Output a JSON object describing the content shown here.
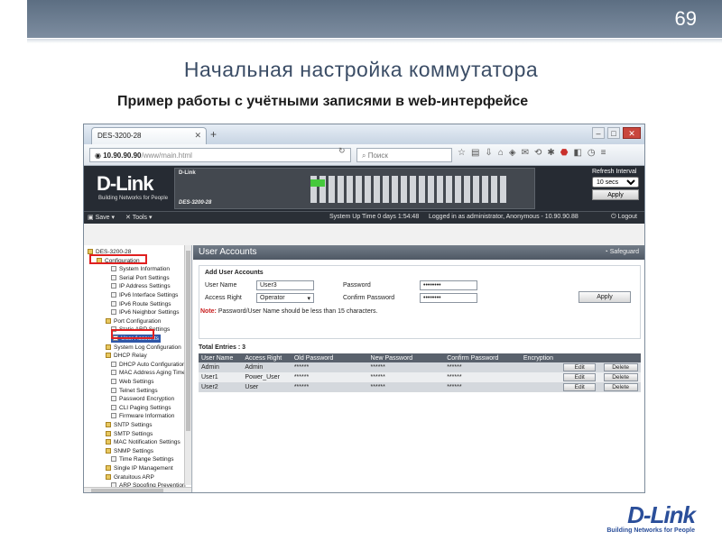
{
  "slide": {
    "page_number": "69",
    "title": "Начальная настройка коммутатора",
    "subtitle": "Пример работы с учётными записями в web-интерфейсе",
    "footer_logo": "D-Link",
    "footer_tagline": "Building Networks for People"
  },
  "browser": {
    "tab_title": "DES-3200-28",
    "url_host": "10.90.90.90",
    "url_path": "/www/main.html",
    "search_placeholder": "Поиск"
  },
  "banner": {
    "logo": "D-Link",
    "tagline": "Building Networks for People",
    "device_brand": "D-Link",
    "device_model": "DES-3200-28",
    "refresh_label": "Refresh Interval",
    "refresh_value": "10 secs",
    "refresh_apply": "Apply"
  },
  "menubar": {
    "save": "Save",
    "tools": "Tools",
    "uptime": "System Up Time 0 days 1:54:48",
    "logged_in": "Logged in as administrator, Anonymous - 10.90.90.88",
    "logout": "Logout"
  },
  "tree": [
    {
      "label": "DES-3200-28",
      "level": 0,
      "folder": true
    },
    {
      "label": "Configuration",
      "level": 1,
      "folder": true
    },
    {
      "label": "System Information",
      "level": 2
    },
    {
      "label": "Serial Port Settings",
      "level": 2
    },
    {
      "label": "IP Address Settings",
      "level": 2
    },
    {
      "label": "IPv6 Interface Settings",
      "level": 2
    },
    {
      "label": "IPv6 Route Settings",
      "level": 2
    },
    {
      "label": "IPv6 Neighbor Settings",
      "level": 2
    },
    {
      "label": "Port Configuration",
      "level": 2,
      "folder": true
    },
    {
      "label": "Static ARP Settings",
      "level": 2
    },
    {
      "label": "User Accounts",
      "level": 2,
      "selected": true
    },
    {
      "label": "System Log Configuration",
      "level": 2,
      "folder": true
    },
    {
      "label": "DHCP Relay",
      "level": 2,
      "folder": true
    },
    {
      "label": "DHCP Auto Configuration",
      "level": 2
    },
    {
      "label": "MAC Address Aging Time",
      "level": 2
    },
    {
      "label": "Web Settings",
      "level": 2
    },
    {
      "label": "Telnet Settings",
      "level": 2
    },
    {
      "label": "Password Encryption",
      "level": 2
    },
    {
      "label": "CLI Paging Settings",
      "level": 2
    },
    {
      "label": "Firmware Information",
      "level": 2
    },
    {
      "label": "SNTP Settings",
      "level": 2,
      "folder": true
    },
    {
      "label": "SMTP Settings",
      "level": 2,
      "folder": true
    },
    {
      "label": "MAC Notification Settings",
      "level": 2,
      "folder": true
    },
    {
      "label": "SNMP Settings",
      "level": 2,
      "folder": true
    },
    {
      "label": "Time Range Settings",
      "level": 2
    },
    {
      "label": "Single IP Management",
      "level": 2,
      "folder": true
    },
    {
      "label": "Gratuitous ARP",
      "level": 2,
      "folder": true
    },
    {
      "label": "ARP Spoofing Prevention",
      "level": 2
    }
  ],
  "panel": {
    "title": "User Accounts",
    "help": "Safeguard",
    "form_title": "Add User Accounts",
    "user_name_label": "User Name",
    "user_name_value": "User3",
    "password_label": "Password",
    "password_value": "••••••••",
    "access_right_label": "Access Right",
    "access_right_value": "Operator",
    "confirm_label": "Confirm Password",
    "confirm_value": "••••••••",
    "apply": "Apply",
    "note_prefix": "Note:",
    "note_text": "Password/User Name should be less than 15 characters.",
    "total": "Total Entries : 3"
  },
  "table": {
    "headers": [
      "User Name",
      "Access Right",
      "Old Password",
      "New Password",
      "Confirm Password",
      "Encryption",
      "",
      ""
    ],
    "edit_label": "Edit",
    "delete_label": "Delete",
    "rows": [
      {
        "name": "Admin",
        "right": "Admin",
        "old": "******",
        "new": "******",
        "confirm": "******"
      },
      {
        "name": "User1",
        "right": "Power_User",
        "old": "******",
        "new": "******",
        "confirm": "******"
      },
      {
        "name": "User2",
        "right": "User",
        "old": "******",
        "new": "******",
        "confirm": "******"
      }
    ]
  }
}
